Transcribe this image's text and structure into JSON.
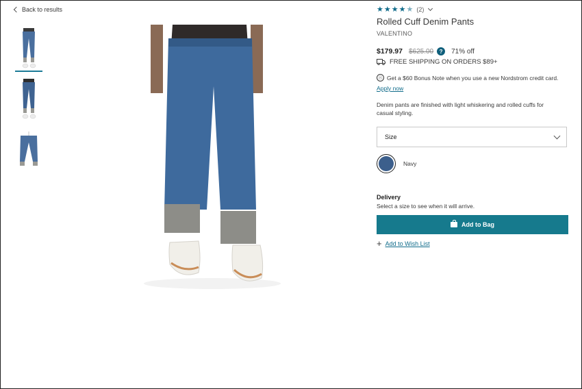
{
  "nav": {
    "back_label": "Back to results"
  },
  "product": {
    "rating_count": "(2)",
    "title": "Rolled Cuff Denim Pants",
    "brand": "VALENTINO",
    "price": "$179.97",
    "original_price": "$625.00",
    "discount": "71% off",
    "shipping": "FREE SHIPPING ON ORDERS $89+",
    "credit_offer": "Get a $60 Bonus Note when you use a new Nordstrom credit card.",
    "apply_now": "Apply now",
    "description": "Denim pants are finished with light whiskering and rolled cuffs for casual styling.",
    "size_label": "Size",
    "color_name": "Navy",
    "delivery_title": "Delivery",
    "delivery_sub": "Select a size to see when it will arrive.",
    "add_to_bag": "Add to Bag",
    "wish_list": "Add to Wish List"
  },
  "icons": {
    "back": "chevron-left-icon",
    "stars": "star-icon",
    "help": "question-icon",
    "shipping": "truck-icon",
    "credit": "card-icon",
    "dropdown": "chevron-down-icon",
    "bag": "bag-icon",
    "plus": "plus-icon"
  },
  "colors": {
    "accent": "#167a8d",
    "link": "#0f6b8a",
    "swatch_navy": "#3c5f8c"
  }
}
